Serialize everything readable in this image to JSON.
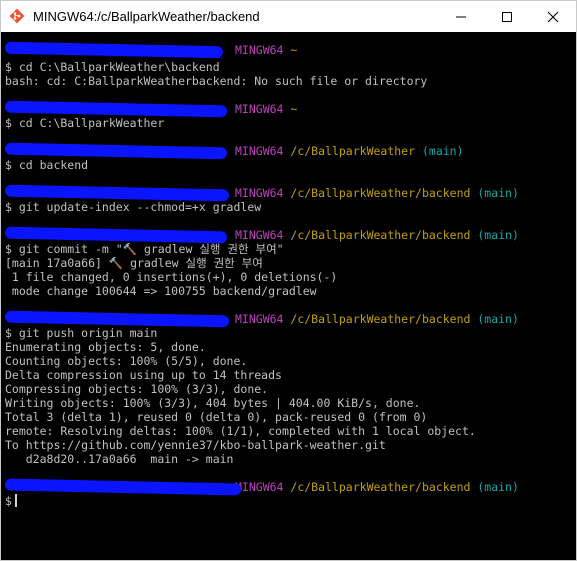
{
  "window": {
    "title": "MINGW64:/c/BallparkWeather/backend",
    "icon": "mingw-git-icon",
    "controls": {
      "minimize": "minimize-icon",
      "maximize": "maximize-icon",
      "close": "close-icon"
    }
  },
  "colors": {
    "env": "#bf40bf",
    "path": "#c0a000",
    "branch": "#13a7a7",
    "text": "#c0c0c0",
    "redaction": "#0a14ff"
  },
  "terminal": {
    "p1": {
      "env": "MINGW64",
      "path": "~"
    },
    "l1": "$ cd C:\\BallparkWeather\\backend",
    "l2": "bash: cd: C:BallparkWeatherbackend: No such file or directory",
    "p2": {
      "env": "MINGW64",
      "path": "~"
    },
    "l3": "$ cd C:\\BallparkWeather",
    "p3": {
      "env": "MINGW64",
      "path": "/c/BallparkWeather",
      "branch": "(main)"
    },
    "l4": "$ cd backend",
    "p4": {
      "env": "MINGW64",
      "path": "/c/BallparkWeather/backend",
      "branch": "(main)"
    },
    "l5": "$ git update-index --chmod=+x gradlew",
    "p5": {
      "env": "MINGW64",
      "path": "/c/BallparkWeather/backend",
      "branch": "(main)"
    },
    "l6": "$ git commit -m \"🔨 gradlew 실행 권한 부여\"",
    "l7": "[main 17a0a66] 🔨 gradlew 실행 권한 부여",
    "l8": " 1 file changed, 0 insertions(+), 0 deletions(-)",
    "l9": " mode change 100644 => 100755 backend/gradlew",
    "p6": {
      "env": "MINGW64",
      "path": "/c/BallparkWeather/backend",
      "branch": "(main)"
    },
    "l10": "$ git push origin main",
    "l11": "Enumerating objects: 5, done.",
    "l12": "Counting objects: 100% (5/5), done.",
    "l13": "Delta compression using up to 14 threads",
    "l14": "Compressing objects: 100% (3/3), done.",
    "l15": "Writing objects: 100% (3/3), 404 bytes | 404.00 KiB/s, done.",
    "l16": "Total 3 (delta 1), reused 0 (delta 0), pack-reused 0 (from 0)",
    "l17": "remote: Resolving deltas: 100% (1/1), completed with 1 local object.",
    "l18": "To https://github.com/yennie37/kbo-ballpark-weather.git",
    "l19": "   d2a8d20..17a0a66  main -> main",
    "p7": {
      "env": "MINGW64",
      "path": "/c/BallparkWeather/backend",
      "branch": "(main)"
    },
    "l20": "$"
  }
}
